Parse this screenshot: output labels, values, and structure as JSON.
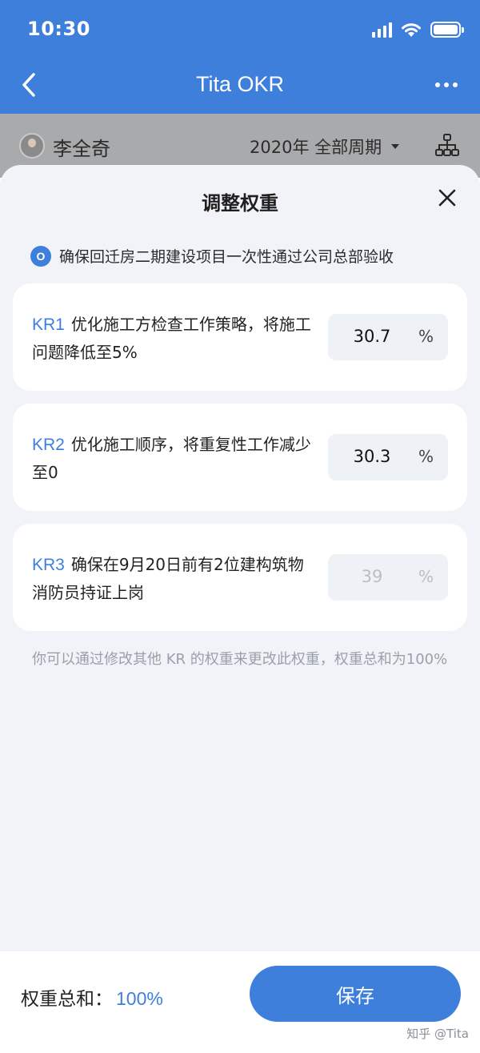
{
  "status_bar": {
    "time": "10:30"
  },
  "nav": {
    "title": "Tita OKR"
  },
  "background": {
    "user_name": "李全奇",
    "period": "2020年 全部周期"
  },
  "sheet": {
    "title": "调整权重",
    "objective": {
      "badge": "O",
      "text": "确保回迁房二期建设项目一次性通过公司总部验收"
    },
    "key_results": [
      {
        "code": "KR1",
        "text": "优化施工方检查工作策略，将施工问题降低至5%",
        "weight": "30.7",
        "unit": "%",
        "editable": true
      },
      {
        "code": "KR2",
        "text": "优化施工顺序，将重复性工作减少至0",
        "weight": "30.3",
        "unit": "%",
        "editable": true
      },
      {
        "code": "KR3",
        "text": "确保在9月20日前有2位建构筑物消防员持证上岗",
        "weight": "39",
        "unit": "%",
        "editable": false
      }
    ],
    "hint": "你可以通过修改其他 KR 的权重来更改此权重，权重总和为100%"
  },
  "footer": {
    "total_label": "权重总和：",
    "total_value": "100%",
    "save_label": "保存",
    "watermark": "知乎 @Tita"
  },
  "colors": {
    "accent": "#3f7fdc",
    "sheet_bg": "#f1f3f8",
    "dim_bg": "#a9aaac"
  }
}
